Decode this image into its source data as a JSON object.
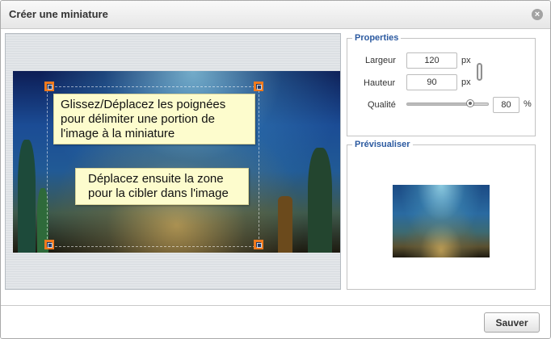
{
  "dialog": {
    "title": "Créer une miniature",
    "close_label": "×"
  },
  "editor": {
    "tips": [
      "Glissez/Déplacez les poignées\npour délimiter une portion de\nl'image à la miniature",
      "Déplacez ensuite la zone\npour la cibler dans l'image"
    ],
    "move_icon": "move-arrows-icon",
    "move_glyph": "✥"
  },
  "properties": {
    "legend": "Properties",
    "width_label": "Largeur",
    "width_value": "120",
    "height_label": "Hauteur",
    "height_value": "90",
    "px_unit": "px",
    "quality_label": "Qualité",
    "quality_value": "80",
    "quality_slider_fraction": 0.78,
    "percent_unit": "%"
  },
  "preview": {
    "legend": "Prévisualiser"
  },
  "footer": {
    "save_label": "Sauver"
  },
  "colors": {
    "accent": "#2c5aa0",
    "handle": "#f07a1e",
    "tip_bg": "#fdfccd"
  }
}
